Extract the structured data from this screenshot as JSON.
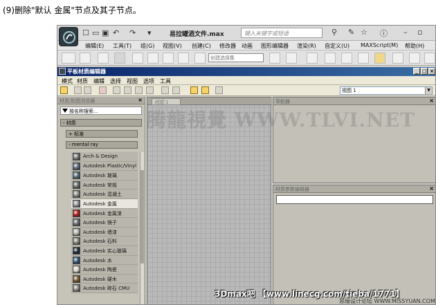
{
  "caption": "(9)删除\"默认 金属\"节点及其子节点。",
  "max": {
    "doc_title": "易拉罐酒文件.max",
    "search_placeholder": "键入关键字或短语",
    "menu": [
      "编辑(E)",
      "工具(T)",
      "组(G)",
      "视图(V)",
      "创建(C)",
      "修改器",
      "动画",
      "图形编辑器",
      "渲染(R)",
      "自定义(U)",
      "MAXScript(M)",
      "帮助(H)"
    ],
    "selection_set": "创建选择集"
  },
  "slate": {
    "title": "平板材质编辑器",
    "menu": [
      "模式",
      "材质",
      "编辑",
      "选择",
      "视图",
      "选项",
      "工具"
    ],
    "view_select": "视图 1",
    "browser_title": "材质/贴图浏览器",
    "search_placeholder": "按名称搜索...",
    "group_materials": "- 材质",
    "group_standard": "+ 标准",
    "group_mentalray": "- mental ray",
    "materials": [
      {
        "name": "Arch & Design",
        "color": "#7a7a7a"
      },
      {
        "name": "Autodesk Plastic/Vinyl",
        "color": "#5e6f7e"
      },
      {
        "name": "Autodesk 玻璃",
        "color": "#5b6f80"
      },
      {
        "name": "Autodesk 常规",
        "color": "#707070"
      },
      {
        "name": "Autodesk 混凝土",
        "color": "#8b8b86"
      },
      {
        "name": "Autodesk 金属",
        "color": "#9a9a9a"
      },
      {
        "name": "Autodesk 金属漆",
        "color": "#b51818"
      },
      {
        "name": "Autodesk 镜子",
        "color": "#6c7078"
      },
      {
        "name": "Autodesk 墙漆",
        "color": "#bcbcb4"
      },
      {
        "name": "Autodesk 石料",
        "color": "#8d8a80"
      },
      {
        "name": "Autodesk 实心玻璃",
        "color": "#1c2a34"
      },
      {
        "name": "Autodesk 水",
        "color": "#2f5577"
      },
      {
        "name": "Autodesk 陶瓷",
        "color": "#d8d6cc"
      },
      {
        "name": "Autodesk 硬木",
        "color": "#7a5a30"
      },
      {
        "name": "Autodesk 砖石 CMU",
        "color": "#8c8c8c"
      }
    ],
    "view_tab": "视图 1",
    "navigator_title": "导航器",
    "params_title": "材质参数编辑器"
  },
  "watermark": "腾龍視覺 WWW.TLVI.NET",
  "credit": "3Dmax吧 【www.linecg.com/tieba/1771】",
  "credit2": "思缘设计论坛 WWW.MISSYUAN.COM"
}
